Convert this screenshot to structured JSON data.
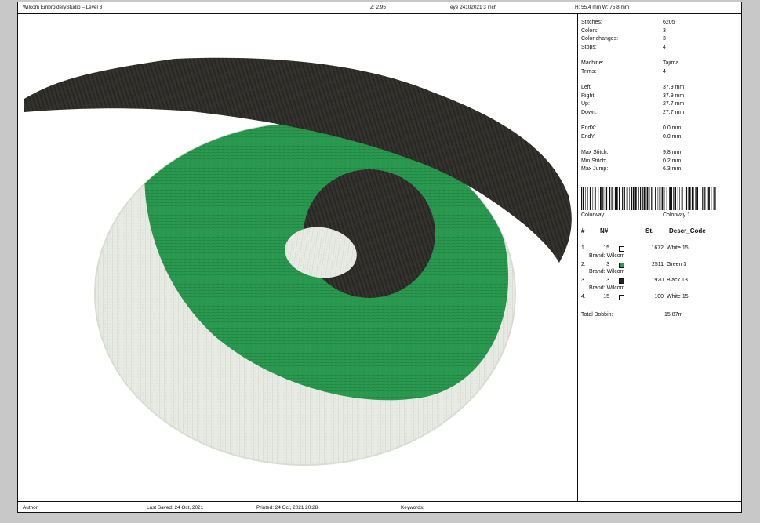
{
  "header": {
    "app_title": "Wilcom EmbroideryStudio – Level 3",
    "zoom": "Z: 2.95",
    "design_name": "eye 24102021 3 inch",
    "size": "H: 55.4 mm   W: 75.8 mm"
  },
  "stats": [
    {
      "label": "Stitches:",
      "value": "6205"
    },
    {
      "label": "Colors:",
      "value": "3"
    },
    {
      "label": "Color changes:",
      "value": "3"
    },
    {
      "label": "Stops:",
      "value": "4"
    },
    {
      "label": "Machine:",
      "value": "Tajima"
    },
    {
      "label": "Trims:",
      "value": "4"
    },
    {
      "label": "Left:",
      "value": "37.9 mm"
    },
    {
      "label": "Right:",
      "value": "37.9 mm"
    },
    {
      "label": "Up:",
      "value": "27.7 mm"
    },
    {
      "label": "Down:",
      "value": "27.7 mm"
    },
    {
      "label": "EndX:",
      "value": "0.0 mm"
    },
    {
      "label": "EndY:",
      "value": "0.0 mm"
    },
    {
      "label": "Max Stitch:",
      "value": "9.8 mm"
    },
    {
      "label": "Min Stitch:",
      "value": "0.2 mm"
    },
    {
      "label": "Max Jump:",
      "value": "6.3 mm"
    }
  ],
  "colorway": {
    "label": "Colorway:",
    "value": "Colorway 1"
  },
  "color_table": {
    "headers": {
      "index": "#",
      "needle": "N#",
      "stitches": "St.",
      "descr_code": "Descr_Code"
    },
    "rows": [
      {
        "index": "1.",
        "needle": "15",
        "color": "#ffffff",
        "stitches": "1672",
        "descr": "White 15",
        "brand": "Brand: Wilcom"
      },
      {
        "index": "2.",
        "needle": "3",
        "color": "#2a9a50",
        "stitches": "2511",
        "descr": "Green 3",
        "brand": "Brand: Wilcom"
      },
      {
        "index": "3.",
        "needle": "13",
        "color": "#222222",
        "stitches": "1920",
        "descr": "Black 13",
        "brand": "Brand: Wilcom"
      },
      {
        "index": "4.",
        "needle": "15",
        "color": "#ffffff",
        "stitches": "100",
        "descr": "White 15",
        "brand": ""
      }
    ],
    "total_bobbin_label": "Total Bobbin:",
    "total_bobbin_value": "15.87m"
  },
  "footer": {
    "author": "Author:",
    "last_saved": "Last Saved: 24 Oct, 2021",
    "printed": "Printed: 24 Oct, 2021 20:28",
    "keywords": "Keywords:"
  },
  "colors": {
    "white_thread": "#e7ebe3",
    "green_thread": "#2a9a50",
    "black_thread": "#2f2e2a"
  }
}
